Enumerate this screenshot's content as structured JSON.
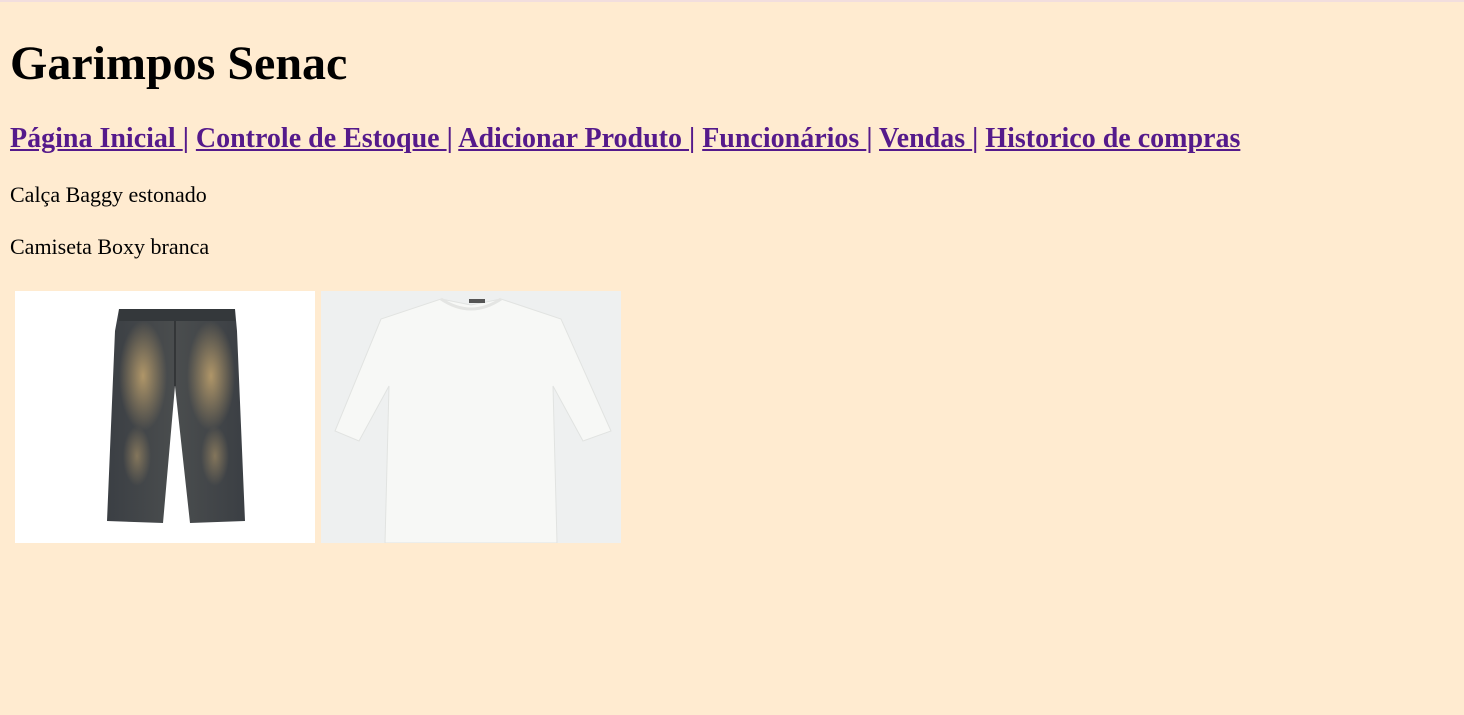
{
  "header": {
    "title": "Garimpos Senac"
  },
  "nav": {
    "items": [
      {
        "label": "Página Inicial "
      },
      {
        "label": "Controle de Estoque "
      },
      {
        "label": "Adicionar Produto "
      },
      {
        "label": "Funcionários "
      },
      {
        "label": "Vendas "
      },
      {
        "label": "Historico de compras"
      }
    ],
    "separator": "|"
  },
  "products": [
    {
      "name": "Calça Baggy estonado",
      "icon": "jeans-image"
    },
    {
      "name": "Camiseta Boxy branca",
      "icon": "tshirt-image"
    }
  ],
  "colors": {
    "background": "#ffebd0",
    "link": "#551a8b"
  }
}
